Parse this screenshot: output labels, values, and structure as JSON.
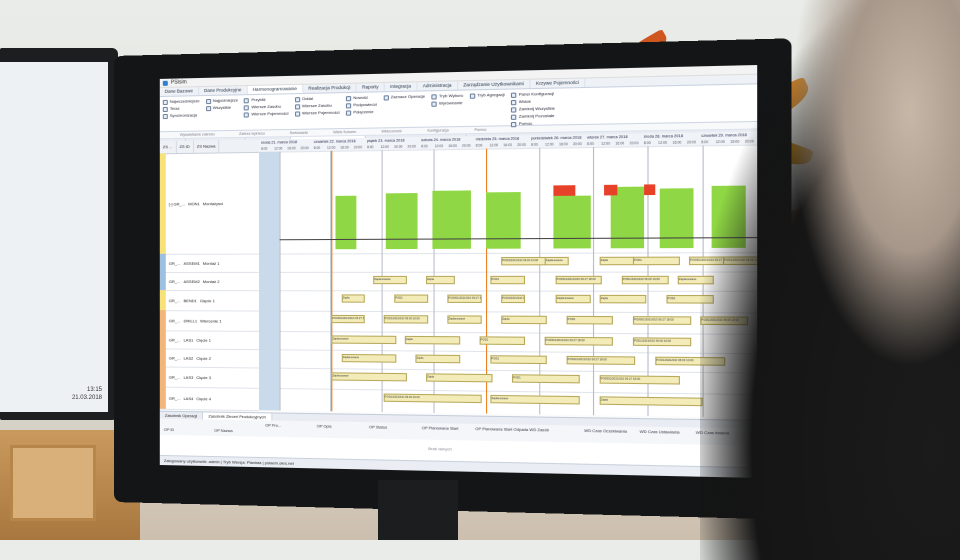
{
  "window": {
    "title": "PSIsim"
  },
  "ribbon": {
    "tabs": [
      "Dane Bazowe",
      "Dane Produkcyjne",
      "Harmonogramowanie",
      "Realizacja Produkcji",
      "Raporty",
      "Integracja",
      "Administracja",
      "Zarządzanie Użytkownikami",
      "Krzywe Pojemności"
    ],
    "groups": [
      {
        "items": [
          "Najwcześniejsze",
          "Teraz",
          "Synchronizacja"
        ]
      },
      {
        "items": [
          "Najpóźniejsze",
          "Wszystkie"
        ]
      },
      {
        "items": [
          "Przybliż",
          "Wiersze Zasobu",
          "Wiersze Pojemności"
        ]
      },
      {
        "items": [
          "Oddal",
          "Wiersze Zasobu",
          "Wiersze Pojemności"
        ]
      },
      {
        "items": [
          "Nowość",
          "Podpowiedzi",
          "Połączenie"
        ]
      },
      {
        "items": [
          "Zaznacz Operacje"
        ]
      },
      {
        "items": [
          "Tryb Wyboru",
          "Wyrównanie"
        ]
      },
      {
        "items": [
          "Tryb Agregacji"
        ]
      },
      {
        "items": [
          "Panel Konfiguracji",
          "Widok",
          "Zamknij Wszystkie",
          "Zamknij Pozostałe",
          "Pomoc"
        ]
      }
    ],
    "captions": [
      "Wyświetlanie zakresu",
      "Zakres wykresu",
      "Sortowanie",
      "Wiele Kolumn",
      "Widoczność",
      "Konfiguracja",
      "Pomoc"
    ]
  },
  "doc_tabs": [
    "Zlecenie",
    "Gantt Zasobów Dwusystych",
    "Krzywe Pojemności",
    "Widok Szczegółowy Zasobu: MON1",
    "Widok Szczegółowy Pojemności Zasobu: MON1"
  ],
  "grid_headers": [
    "ZS ...",
    "ZS ID",
    "ZS Nazwa"
  ],
  "days": [
    "środa 21. marca 2018",
    "czwartek 22. marca 2018",
    "piątek 23. marca 2018",
    "sobota 24. marca 2018",
    "niedziela 25. marca 2018",
    "poniedziałek 26. marca 2018",
    "wtorek 27. marca 2018",
    "środa 28. marca 2018",
    "czwartek 29. marca 2018"
  ],
  "hour_labels": [
    "8:00",
    "12:00",
    "16:00",
    "20:00"
  ],
  "rows": [
    {
      "group": "[-] GR_...",
      "id": "MON1",
      "name": "Montażyści",
      "color": "#f7e27a"
    },
    {
      "group": "GR_...",
      "id": "ASSEM1",
      "name": "Montaż 1",
      "color": "#9fbfe0"
    },
    {
      "group": "GR_...",
      "id": "ASSEM2",
      "name": "Montaż 2",
      "color": "#9fbfe0"
    },
    {
      "group": "GR_...",
      "id": "BEND1",
      "name": "Gięcie 1",
      "color": "#f7e27a"
    },
    {
      "group": "GR_...",
      "id": "DRILL1",
      "name": "Wiercenie 1",
      "color": "#f2b67a"
    },
    {
      "group": "GR_...",
      "id": "LAS1",
      "name": "Cięcie 1",
      "color": "#f2b67a"
    },
    {
      "group": "GR_...",
      "id": "LAS2",
      "name": "Cięcie 2",
      "color": "#f2b67a"
    },
    {
      "group": "GR_...",
      "id": "LAS3",
      "name": "Cięcie 3",
      "color": "#f2b67a"
    },
    {
      "group": "GR_...",
      "id": "LAS4",
      "name": "Cięcie 4",
      "color": "#f2b67a"
    }
  ],
  "task_labels": [
    "POD1/2021/010 06:00 10:00",
    "Zaplanowane",
    "Zapla",
    "POD1",
    "PO0001/2021/010 06:27 18:00"
  ],
  "bottom_tabs": [
    "Zasobnik Operacji",
    "Zasobnik Zleceń Produkcyjnych"
  ],
  "op_columns": [
    "OP ID",
    "OP Nazwa",
    "OP Pro...",
    "OP Opis",
    "OP Status",
    "OP Planowana Start",
    "OP Planowana Start Odpada",
    "WD Zasób",
    "WD Czas Oczekiwania",
    "WD Czas Ustawiania",
    "WD Czas trwania"
  ],
  "op_empty": "Brak danych",
  "statusbar": "Zalogowany użytkownik: admin | Tryb Wersja: Planista | psiaem.okrs.net",
  "clock": {
    "time": "13:15",
    "date": "21.03.2018"
  },
  "colors": {
    "capacity_bar": "#8fd744",
    "overload": "#e8412a",
    "now_line": "#f07c1c"
  }
}
